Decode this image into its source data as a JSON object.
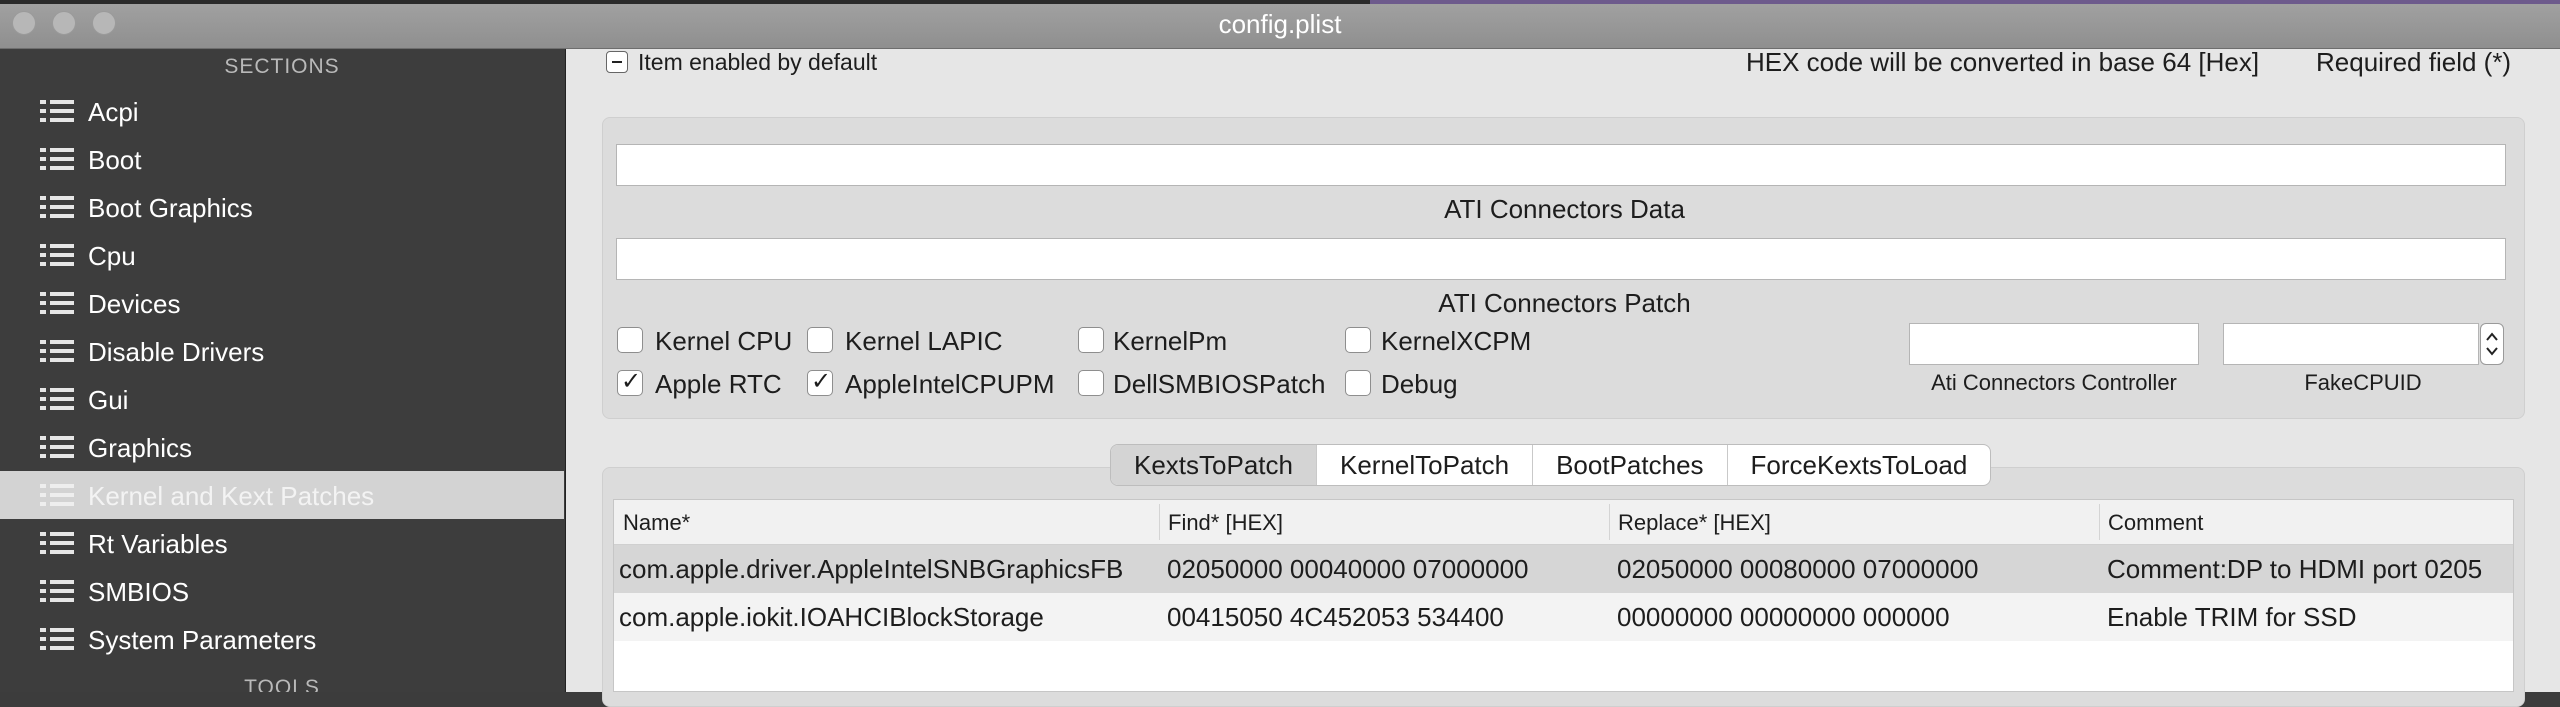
{
  "window": {
    "title": "config.plist"
  },
  "sidebar": {
    "sections_header": "SECTIONS",
    "items": [
      {
        "label": "Acpi"
      },
      {
        "label": "Boot"
      },
      {
        "label": "Boot Graphics"
      },
      {
        "label": "Cpu"
      },
      {
        "label": "Devices"
      },
      {
        "label": "Disable Drivers"
      },
      {
        "label": "Gui"
      },
      {
        "label": "Graphics"
      },
      {
        "label": "Kernel and Kext Patches",
        "selected": true
      },
      {
        "label": "Rt Variables"
      },
      {
        "label": "SMBIOS"
      },
      {
        "label": "System Parameters"
      }
    ],
    "tools_header": "TOOLS"
  },
  "header": {
    "enabled_default_label": "Item enabled by default",
    "hex_note": "HEX code will be converted in base 64 [Hex]",
    "required_note": "Required field (*)"
  },
  "kernel": {
    "ati_connectors_data": {
      "label": "ATI Connectors Data",
      "value": ""
    },
    "ati_connectors_patch": {
      "label": "ATI Connectors Patch",
      "value": ""
    },
    "checkboxes": [
      {
        "label": "Kernel CPU",
        "checked": false
      },
      {
        "label": "Kernel LAPIC",
        "checked": false
      },
      {
        "label": "KernelPm",
        "checked": false
      },
      {
        "label": "KernelXCPM",
        "checked": false
      },
      {
        "label": "Apple RTC",
        "checked": true
      },
      {
        "label": "AppleIntelCPUPM",
        "checked": true
      },
      {
        "label": "DellSMBIOSPatch",
        "checked": false
      },
      {
        "label": "Debug",
        "checked": false
      }
    ],
    "ati_connectors_controller": {
      "label": "Ati Connectors Controller",
      "value": ""
    },
    "fake_cpuid": {
      "label": "FakeCPUID",
      "value": ""
    }
  },
  "tabs": [
    {
      "label": "KextsToPatch",
      "active": true
    },
    {
      "label": "KernelToPatch"
    },
    {
      "label": "BootPatches"
    },
    {
      "label": "ForceKextsToLoad"
    }
  ],
  "table": {
    "columns": [
      "Name*",
      "Find* [HEX]",
      "Replace* [HEX]",
      "Comment"
    ],
    "rows": [
      [
        "com.apple.driver.AppleIntelSNBGraphicsFB",
        "02050000 00040000 07000000",
        "02050000 00080000 07000000",
        "Comment:DP to HDMI port 0205"
      ],
      [
        "com.apple.iokit.IOAHCIBlockStorage",
        "00415050 4C452053 534400",
        "00000000 00000000 000000",
        "Enable TRIM for SSD"
      ]
    ]
  },
  "colors": {
    "sidebar_bg": "#3d3d3d",
    "sidebar_selected": "#d3d3d3",
    "main_bg": "#e6e6e6",
    "selected_row": "#d6d6d6"
  }
}
